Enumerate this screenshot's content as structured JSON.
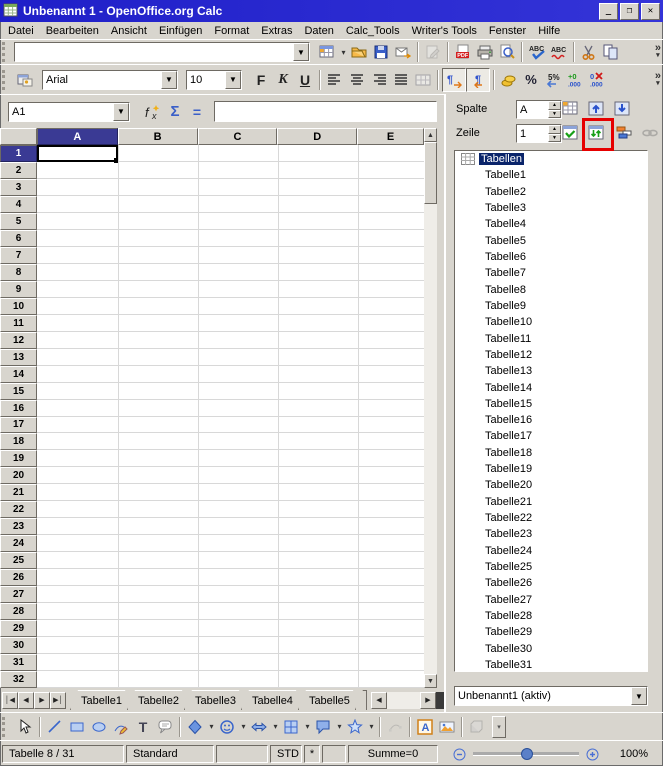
{
  "window": {
    "title": "Unbenannt 1 - OpenOffice.org Calc"
  },
  "menu_items": [
    "Datei",
    "Bearbeiten",
    "Ansicht",
    "Einfügen",
    "Format",
    "Extras",
    "Daten",
    "Calc_Tools",
    "Writer's Tools",
    "Fenster",
    "Hilfe"
  ],
  "toolbar": {
    "url_value": "",
    "overflow_label": "»"
  },
  "formatting": {
    "font_name": "Arial",
    "font_size": "10",
    "bold_label": "F",
    "italic_label": "K",
    "underline_label": "U"
  },
  "formula_bar": {
    "cell_reference": "A1",
    "fx_label": "fx",
    "sum_label": "Σ",
    "equals_label": "=",
    "input_value": ""
  },
  "icon_labels": {
    "spellcheck": "ABC",
    "autospellcheck": "ABC",
    "percent": "%",
    "standard_format": "5%",
    "add_decimal_top": "+0",
    "add_decimal_bottom": ".000",
    "del_decimal_top": "0",
    "del_decimal_bottom": ".000",
    "text_tool": "T",
    "fontwork": "A"
  },
  "grid": {
    "column_headers": [
      "A",
      "B",
      "C",
      "D",
      "E"
    ],
    "row_count": 32,
    "selected_column": "A",
    "selected_row": 1
  },
  "sheet_tabs": [
    "Tabelle1",
    "Tabelle2",
    "Tabelle3",
    "Tabelle4",
    "Tabelle5"
  ],
  "navigator": {
    "column_label": "Spalte",
    "column_value": "A",
    "row_label": "Zeile",
    "row_value": "1",
    "tree_root": "Tabellen",
    "sheets": [
      "Tabelle1",
      "Tabelle2",
      "Tabelle3",
      "Tabelle4",
      "Tabelle5",
      "Tabelle6",
      "Tabelle7",
      "Tabelle8",
      "Tabelle9",
      "Tabelle10",
      "Tabelle11",
      "Tabelle12",
      "Tabelle13",
      "Tabelle14",
      "Tabelle15",
      "Tabelle16",
      "Tabelle17",
      "Tabelle18",
      "Tabelle19",
      "Tabelle20",
      "Tabelle21",
      "Tabelle22",
      "Tabelle23",
      "Tabelle24",
      "Tabelle25",
      "Tabelle26",
      "Tabelle27",
      "Tabelle28",
      "Tabelle29",
      "Tabelle30",
      "Tabelle31"
    ],
    "document_selector": "Unbenannt1 (aktiv)"
  },
  "status_bar": {
    "sheet_info": "Tabelle 8 / 31",
    "page_style": "Standard",
    "selection_mode": "STD",
    "modified_flag": "*",
    "sum_display": "Summe=0",
    "zoom_level": "100%"
  }
}
